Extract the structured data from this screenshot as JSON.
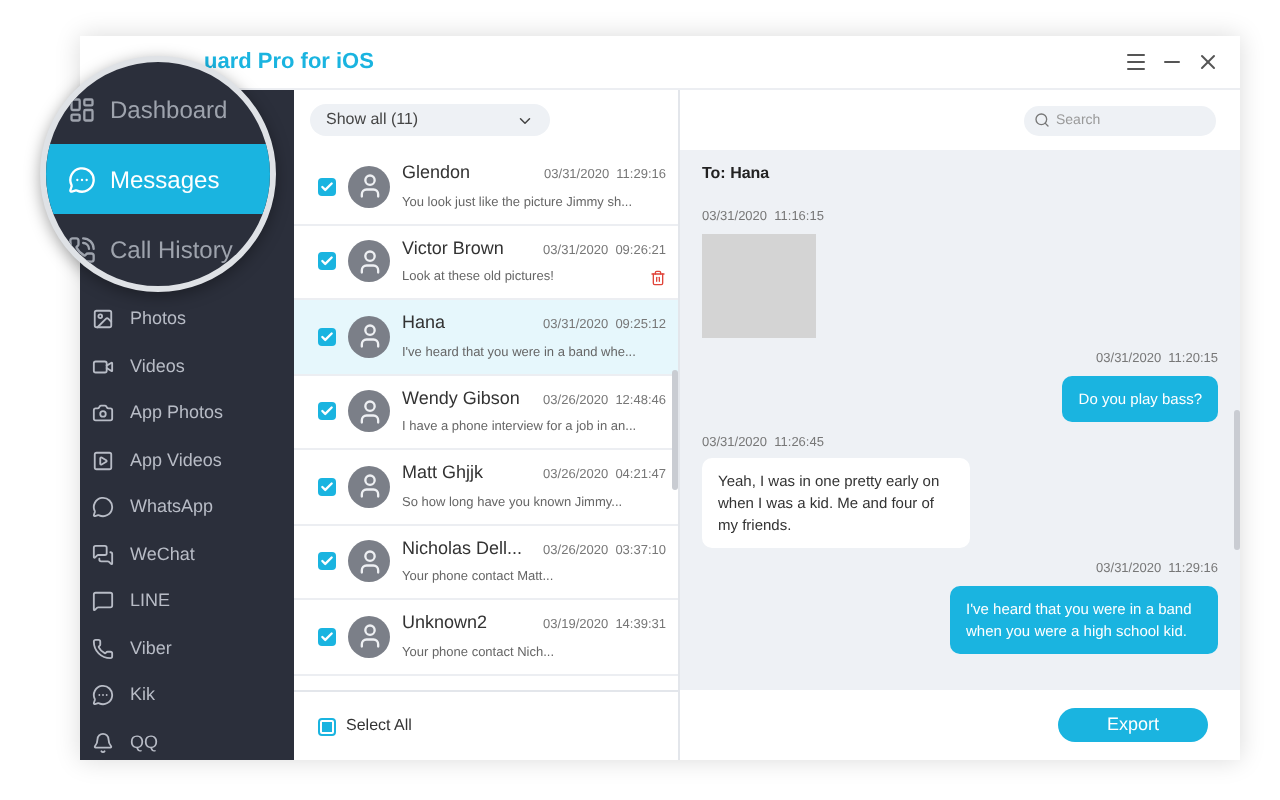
{
  "window": {
    "title": "uard Pro for iOS"
  },
  "magnifier": {
    "items": [
      {
        "label": "Dashboard",
        "selected": false
      },
      {
        "label": "Messages",
        "selected": true
      },
      {
        "label": "Call History",
        "selected": false
      }
    ]
  },
  "sidebar": {
    "items": [
      {
        "label": "Photos"
      },
      {
        "label": "Videos"
      },
      {
        "label": "App Photos"
      },
      {
        "label": "App Videos"
      },
      {
        "label": "WhatsApp"
      },
      {
        "label": "WeChat"
      },
      {
        "label": "LINE"
      },
      {
        "label": "Viber"
      },
      {
        "label": "Kik"
      },
      {
        "label": "QQ"
      }
    ]
  },
  "list": {
    "filter": "Show all (11)",
    "rows": [
      {
        "name": "Glendon",
        "stamp": "03/31/2020  11:29:16",
        "preview": "You look just like the picture Jimmy sh...",
        "checked": true,
        "selected": false,
        "delete_shown": false
      },
      {
        "name": "Victor Brown",
        "stamp": "03/31/2020  09:26:21",
        "preview": "Look at these old pictures!",
        "checked": true,
        "selected": false,
        "delete_shown": true
      },
      {
        "name": "Hana",
        "stamp": "03/31/2020  09:25:12",
        "preview": "I've heard that you were in a band whe...",
        "checked": true,
        "selected": true,
        "delete_shown": false
      },
      {
        "name": "Wendy Gibson",
        "stamp": "03/26/2020  12:48:46",
        "preview": "I have a phone interview for a job in an...",
        "checked": true,
        "selected": false,
        "delete_shown": false
      },
      {
        "name": "Matt Ghjjk",
        "stamp": "03/26/2020  04:21:47",
        "preview": "So how long have you known Jimmy...",
        "checked": true,
        "selected": false,
        "delete_shown": false
      },
      {
        "name": "Nicholas Dell...",
        "stamp": "03/26/2020  03:37:10",
        "preview": "Your phone contact Matt...",
        "checked": true,
        "selected": false,
        "delete_shown": false
      },
      {
        "name": "Unknown2",
        "stamp": "03/19/2020  14:39:31",
        "preview": "Your phone contact Nich...",
        "checked": true,
        "selected": false,
        "delete_shown": false
      }
    ],
    "select_all": {
      "label": "Select All",
      "partial": true
    }
  },
  "conversation": {
    "search_placeholder": "Search",
    "title": "To: Hana",
    "messages": [
      {
        "kind": "image",
        "outgoing": false,
        "stamp": "03/31/2020  11:16:15"
      },
      {
        "kind": "text",
        "outgoing": true,
        "stamp": "03/31/2020  11:20:15",
        "text": "Do you play bass?"
      },
      {
        "kind": "text",
        "outgoing": false,
        "stamp": "03/31/2020  11:26:45",
        "text": "Yeah, I was in one pretty early on when I was a kid. Me and four of my friends."
      },
      {
        "kind": "text",
        "outgoing": true,
        "stamp": "03/31/2020  11:29:16",
        "text": "I've heard that you were in a band when you were a high school kid."
      }
    ],
    "export_button": "Export"
  }
}
